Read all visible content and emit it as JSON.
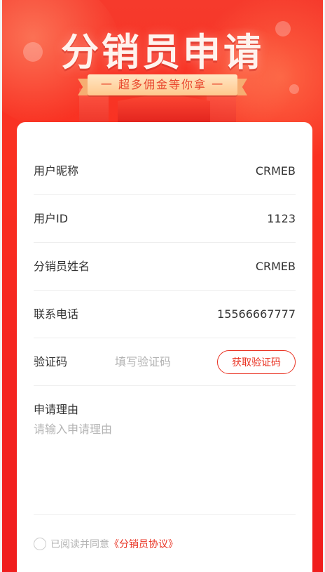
{
  "banner": {
    "title": "分销员申请",
    "subtitle": "一 超多佣金等你拿 一"
  },
  "form": {
    "rows": [
      {
        "label": "用户昵称",
        "value": "CRMEB"
      },
      {
        "label": "用户ID",
        "value": "1123"
      },
      {
        "label": "分销员姓名",
        "value": "CRMEB"
      },
      {
        "label": "联系电话",
        "value": "15566667777"
      }
    ],
    "code": {
      "label": "验证码",
      "placeholder": "填写验证码",
      "button": "获取验证码"
    },
    "reason": {
      "label": "申请理由",
      "placeholder": "请输入申请理由"
    },
    "agreement": {
      "prefix": "已阅读并同意",
      "link": "《分销员协议》"
    }
  },
  "colors": {
    "accent": "#e93323",
    "background_red": "#f63a2c",
    "ribbon": "#ffd9a8"
  }
}
